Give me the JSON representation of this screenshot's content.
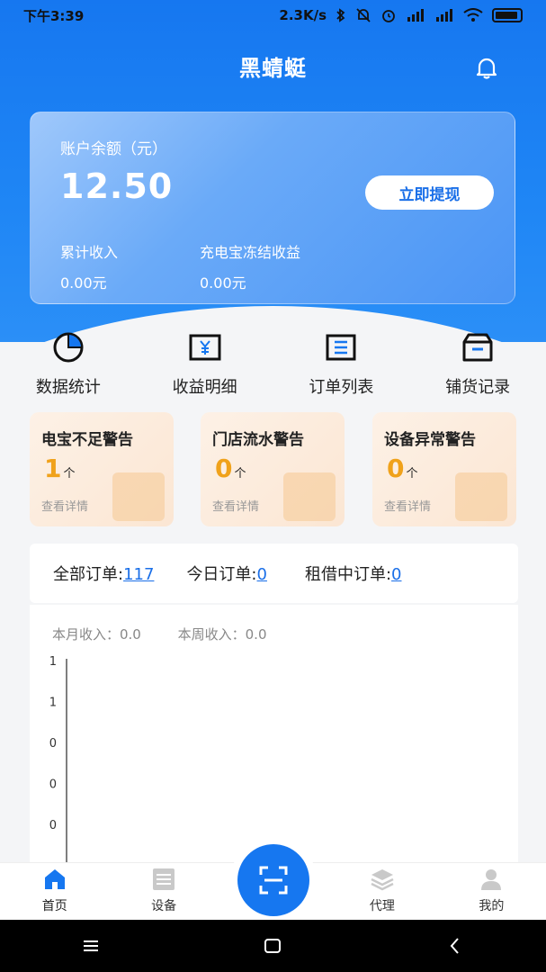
{
  "status_bar": {
    "time": "下午3:39",
    "speed": "2.3K/s"
  },
  "header": {
    "title": "黑蜻蜓"
  },
  "balance": {
    "label": "账户余额（元）",
    "amount": "12.50",
    "withdraw_label": "立即提现",
    "total_income_label": "累计收入",
    "total_income_value": "0.00元",
    "frozen_label": "充电宝冻结收益",
    "frozen_value": "0.00元"
  },
  "quick_menu": [
    {
      "label": "数据统计",
      "icon": "pie-chart-icon"
    },
    {
      "label": "收益明细",
      "icon": "yuan-receipt-icon"
    },
    {
      "label": "订单列表",
      "icon": "list-icon"
    },
    {
      "label": "铺货记录",
      "icon": "box-icon"
    }
  ],
  "warnings": [
    {
      "title": "电宝不足警告",
      "count": "1",
      "unit": "个",
      "link": "查看详情"
    },
    {
      "title": "门店流水警告",
      "count": "0",
      "unit": "个",
      "link": "查看详情"
    },
    {
      "title": "设备异常警告",
      "count": "0",
      "unit": "个",
      "link": "查看详情"
    }
  ],
  "orders": {
    "all_label": "全部订单:",
    "all_value": "117",
    "today_label": "今日订单:",
    "today_value": "0",
    "renting_label": "租借中订单:",
    "renting_value": "0"
  },
  "income": {
    "month_label": "本月收入：0.0",
    "week_label": "本周收入：0.0"
  },
  "chart_data": {
    "type": "line",
    "title": "",
    "y_tick_labels": [
      "1",
      "1",
      "0",
      "0",
      "0"
    ],
    "series": []
  },
  "tabbar": [
    {
      "label": "首页",
      "icon": "home-icon",
      "active": true
    },
    {
      "label": "设备",
      "icon": "device-grid-icon",
      "active": false
    },
    {
      "label": "",
      "icon": "scan-icon",
      "active": false
    },
    {
      "label": "代理",
      "icon": "layers-icon",
      "active": false
    },
    {
      "label": "我的",
      "icon": "user-icon",
      "active": false
    }
  ],
  "colors": {
    "primary": "#1677f0",
    "warning_number": "#f0a21b",
    "link": "#1a6fe8"
  }
}
